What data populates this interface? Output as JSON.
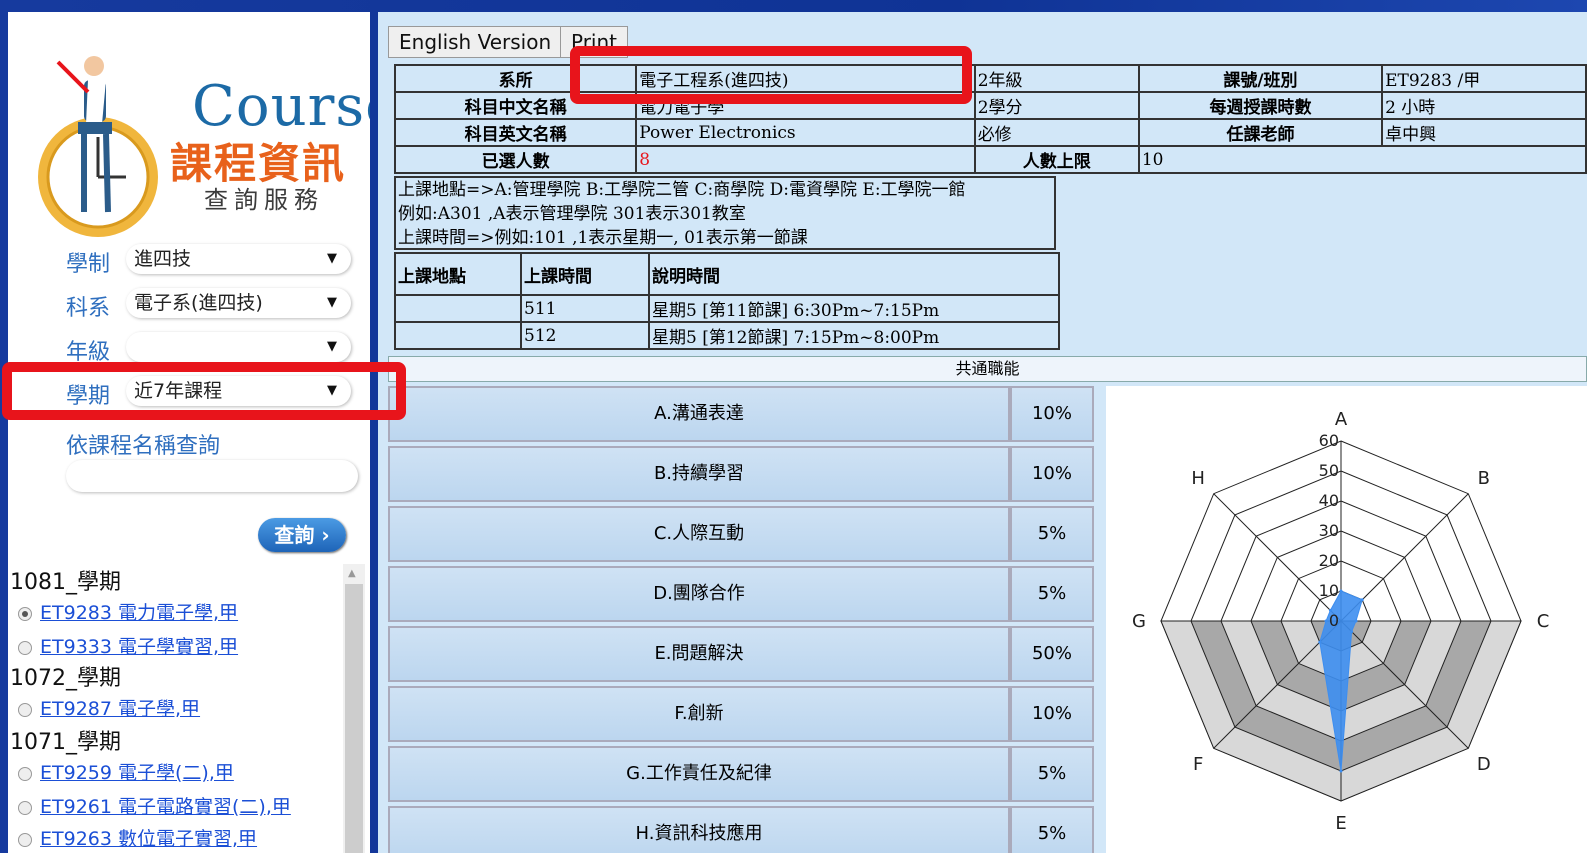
{
  "sidebar": {
    "logo": {
      "course": "Course",
      "cn": "課程資訊",
      "sub": "查詢服務"
    },
    "filters": [
      {
        "label": "學制",
        "value": "進四技"
      },
      {
        "label": "科系",
        "value": "電子系(進四技)"
      },
      {
        "label": "年級",
        "value": ""
      },
      {
        "label": "學期",
        "value": "近7年課程"
      }
    ],
    "by_name_label": "依課程名稱查詢",
    "name_input_value": "",
    "query_button": "查詢",
    "semesters": [
      {
        "label": "1081_學期",
        "courses": [
          {
            "text": "ET9283 電力電子學,甲",
            "selected": true
          },
          {
            "text": "ET9333 電子學實習,甲",
            "selected": false
          }
        ]
      },
      {
        "label": "1072_學期",
        "courses": [
          {
            "text": "ET9287 電子學,甲",
            "selected": false
          }
        ]
      },
      {
        "label": "1071_學期",
        "courses": [
          {
            "text": "ET9259 電子學(二),甲",
            "selected": false
          },
          {
            "text": "ET9261 電子電路實習(二),甲",
            "selected": false
          },
          {
            "text": "ET9263 數位電子實習,甲",
            "selected": false
          }
        ]
      }
    ]
  },
  "toolbar": {
    "english": "English Version",
    "print": "Print"
  },
  "info": {
    "dept_label": "系所",
    "dept": "電子工程系(進四技)",
    "grade": "2年級",
    "code_label": "課號/班別",
    "code": "ET9283 /甲",
    "cname_label": "科目中文名稱",
    "cname": "電力電子學",
    "credits": "2學分",
    "hours_label": "每週授課時數",
    "hours": "2 小時",
    "ename_label": "科目英文名稱",
    "ename": "Power Electronics",
    "required": "必修",
    "teacher_label": "任課老師",
    "teacher": "卓中興",
    "enrolled_label": "已選人數",
    "enrolled": "8",
    "limit_label": "人數上限",
    "limit": "10"
  },
  "notes": [
    "上課地點=>A:管理學院 B:工學院二管 C:商學院 D:電資學院 E:工學院一館",
    "例如:A301 ,A表示管理學院 301表示301教室",
    "上課時間=>例如:101 ,1表示星期一, 01表示第一節課"
  ],
  "schedule": {
    "headers": [
      "上課地點",
      "上課時間",
      "說明時間"
    ],
    "rows": [
      {
        "place": "",
        "time": "511",
        "desc": "星期5 [第11節課] 6:30Pm~7:15Pm"
      },
      {
        "place": "",
        "time": "512",
        "desc": "星期5 [第12節課] 7:15Pm~8:00Pm"
      }
    ]
  },
  "competency": {
    "title": "共通職能",
    "items": [
      {
        "name": "A.溝通表達",
        "pct": "10%"
      },
      {
        "name": "B.持續學習",
        "pct": "10%"
      },
      {
        "name": "C.人際互動",
        "pct": "5%"
      },
      {
        "name": "D.團隊合作",
        "pct": "5%"
      },
      {
        "name": "E.問題解決",
        "pct": "50%"
      },
      {
        "name": "F.創新",
        "pct": "10%"
      },
      {
        "name": "G.工作責任及紀律",
        "pct": "5%"
      },
      {
        "name": "H.資訊科技應用",
        "pct": "5%"
      }
    ]
  },
  "chart_data": {
    "type": "radar",
    "categories": [
      "A",
      "B",
      "C",
      "D",
      "E",
      "F",
      "G",
      "H"
    ],
    "values": [
      10,
      10,
      5,
      5,
      50,
      10,
      5,
      5
    ],
    "ticks": [
      0,
      10,
      20,
      30,
      40,
      50,
      60
    ],
    "rlim": [
      0,
      60
    ],
    "series_color": "#3d8ef0"
  },
  "colors": {
    "highlight": "#e8141b",
    "link": "#1b4fd6",
    "label_blue": "#2f6fbf",
    "logo_orange": "#e8611b"
  }
}
